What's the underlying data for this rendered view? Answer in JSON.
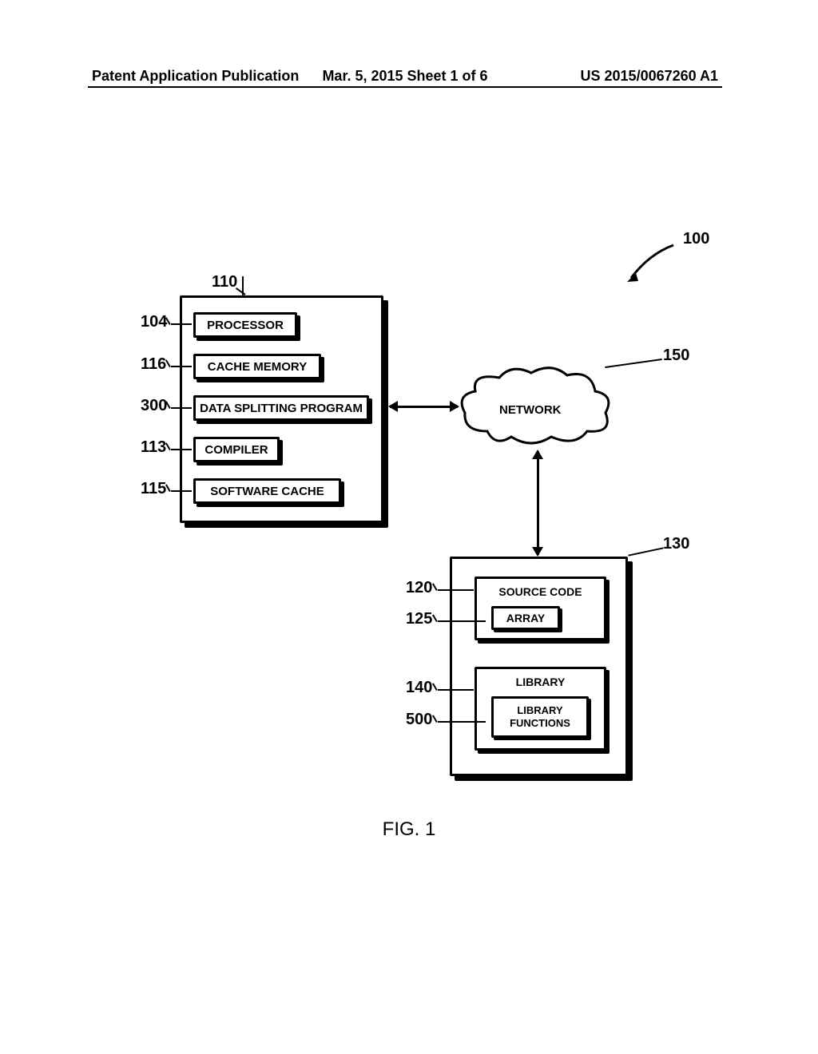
{
  "header": {
    "left": "Patent Application Publication",
    "center": "Mar. 5, 2015  Sheet 1 of 6",
    "right": "US 2015/0067260 A1"
  },
  "refs": {
    "r100": "100",
    "r110": "110",
    "r104": "104",
    "r116": "116",
    "r300": "300",
    "r113": "113",
    "r115": "115",
    "r150": "150",
    "r130": "130",
    "r120": "120",
    "r125": "125",
    "r140": "140",
    "r500": "500"
  },
  "box110": {
    "processor": "PROCESSOR",
    "cache": "CACHE MEMORY",
    "split": "DATA SPLITTING PROGRAM",
    "compiler": "COMPILER",
    "swcache": "SOFTWARE CACHE"
  },
  "network": "NETWORK",
  "box130": {
    "source_code": "SOURCE CODE",
    "array": "ARRAY",
    "library": "LIBRARY",
    "library_functions": "LIBRARY\nFUNCTIONS"
  },
  "figure": "FIG. 1"
}
